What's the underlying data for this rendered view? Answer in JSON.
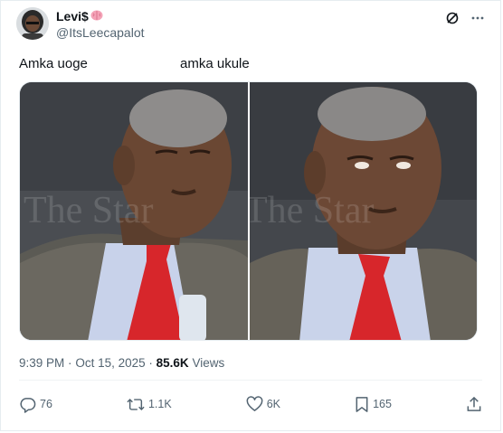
{
  "author": {
    "display_name": "Levi$",
    "handle": "@ItsLeecapalot",
    "avatar": "profile-avatar",
    "name_emoji": "brain-icon"
  },
  "header_icons": [
    "grok-icon",
    "more-icon"
  ],
  "tweet": {
    "text_left": "Amka uoge",
    "text_right": "amka ukule"
  },
  "media": {
    "watermark": "The Star",
    "images": [
      "man-sleeping-photo",
      "man-tired-photo"
    ]
  },
  "meta": {
    "time": "9:39 PM",
    "separator": "·",
    "date": "Oct 15, 2025",
    "views_count": "85.6K",
    "views_label": "Views"
  },
  "actions": {
    "replies": "76",
    "reposts": "1.1K",
    "likes": "6K",
    "bookmarks": "165"
  },
  "colors": {
    "text": "#0f1419",
    "secondary": "#536471",
    "tie": "#d7262b",
    "border": "#e6ecf0"
  }
}
